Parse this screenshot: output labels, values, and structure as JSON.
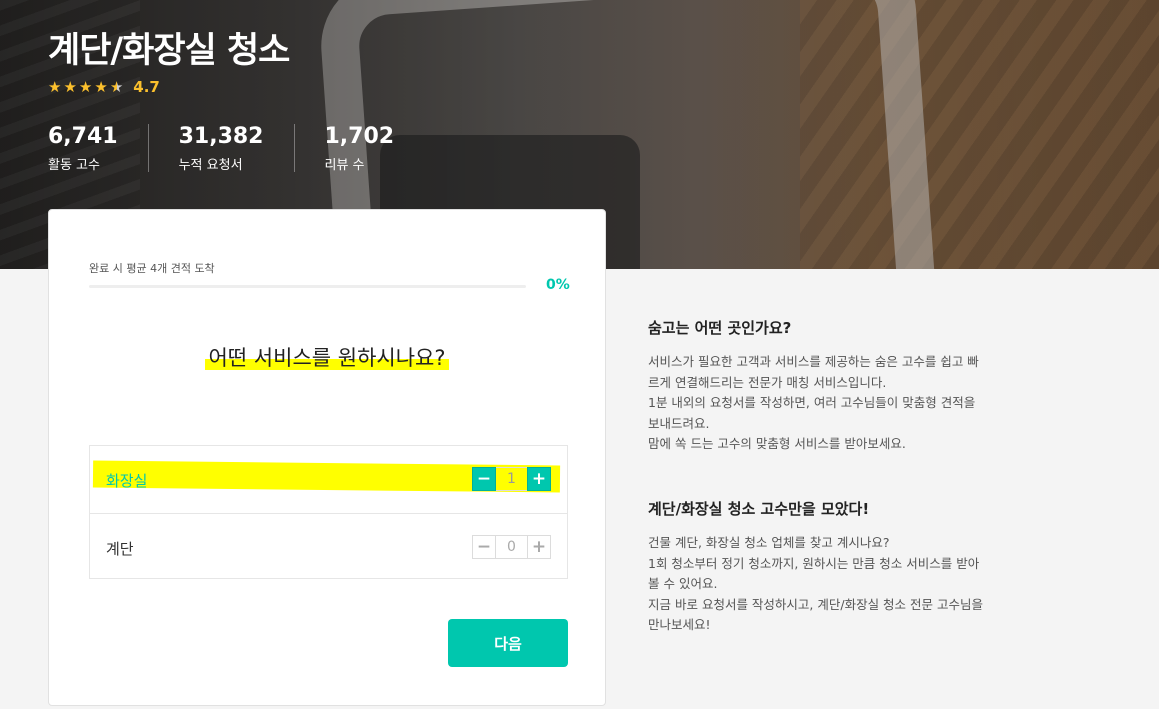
{
  "hero": {
    "title": "계단/화장실 청소",
    "rating": "4.7",
    "stats": [
      {
        "value": "6,741",
        "label": "활동 고수"
      },
      {
        "value": "31,382",
        "label": "누적 요청서"
      },
      {
        "value": "1,702",
        "label": "리뷰 수"
      }
    ]
  },
  "card": {
    "progress_label": "완료 시 평균 4개 견적 도착",
    "progress_percent": "0%",
    "progress_fraction": 0,
    "question": "어떤 서비스를 원하시나요?",
    "options": [
      {
        "label": "화장실",
        "count": "1",
        "minus": "−",
        "plus": "+"
      },
      {
        "label": "계단",
        "count": "0",
        "minus": "−",
        "plus": "+"
      }
    ],
    "next_label": "다음"
  },
  "side": {
    "section1": {
      "title": "숨고는 어떤 곳인가요?",
      "lines": [
        "서비스가 필요한 고객과 서비스를 제공하는 숨은 고수를 쉽고 빠",
        "르게 연결해드리는 전문가 매칭 서비스입니다.",
        "1분 내외의 요청서를 작성하면, 여러 고수님들이 맞춤형 견적을",
        "보내드려요.",
        "맘에 쏙 드는 고수의 맞춤형 서비스를 받아보세요."
      ]
    },
    "section2": {
      "title": "계단/화장실 청소 고수만을 모았다!",
      "lines": [
        "건물 계단, 화장실 청소 업체를 찾고 계시나요?",
        "1회 청소부터 정기 청소까지, 원하시는 만큼 청소 서비스를 받아",
        "볼 수 있어요.",
        "지금 바로 요청서를 작성하시고, 계단/화장실 청소 전문 고수님을",
        "만나보세요!"
      ]
    }
  },
  "colors": {
    "accent": "#00c7ae",
    "star": "#fbc02d",
    "highlight": "#ffff00"
  },
  "icons": {
    "star": "star-icon",
    "minus": "minus-icon",
    "plus": "plus-icon"
  }
}
